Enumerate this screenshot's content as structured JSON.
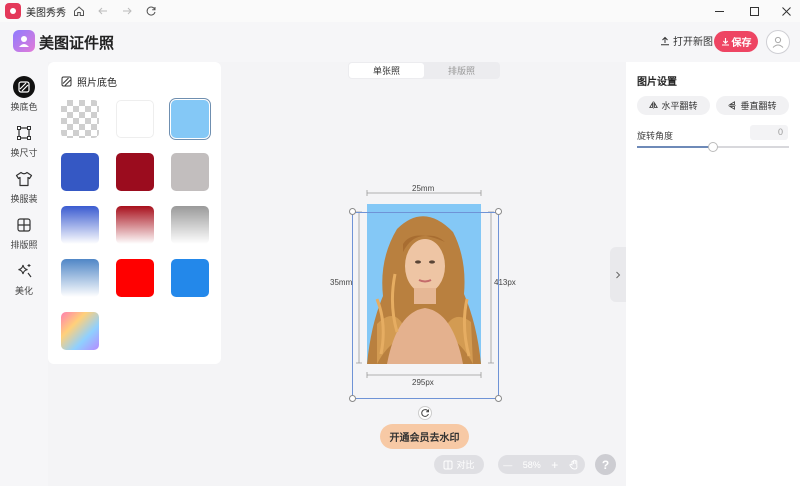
{
  "window": {
    "app_name": "美图秀秀"
  },
  "header": {
    "brand": "美图证件照",
    "open_new": "打开新图",
    "save": "保存"
  },
  "rail": [
    {
      "label": "换底色",
      "icon": "background-color-icon",
      "active": true
    },
    {
      "label": "换尺寸",
      "icon": "crop-size-icon",
      "active": false
    },
    {
      "label": "换服装",
      "icon": "tshirt-icon",
      "active": false
    },
    {
      "label": "排版照",
      "icon": "grid-layout-icon",
      "active": false
    },
    {
      "label": "美化",
      "icon": "sparkle-icon",
      "active": false
    }
  ],
  "color_panel": {
    "title": "照片底色",
    "swatches": [
      {
        "name": "transparent",
        "fill": "checker",
        "selected": false
      },
      {
        "name": "white",
        "fill": "#ffffff",
        "selected": false
      },
      {
        "name": "light-blue",
        "fill": "#84c8f6",
        "selected": true
      },
      {
        "name": "blue",
        "fill": "#3558c4",
        "selected": false
      },
      {
        "name": "dark-red",
        "fill": "#9b0c1e",
        "selected": false
      },
      {
        "name": "grey",
        "fill": "#c2bebe",
        "selected": false
      },
      {
        "name": "blue-gradient",
        "fill": "linear-gradient(#3a5bd0,#ffffff)",
        "selected": false
      },
      {
        "name": "red-gradient",
        "fill": "linear-gradient(#a8101c,#ffffff)",
        "selected": false
      },
      {
        "name": "grey-gradient",
        "fill": "linear-gradient(#9a9a9a,#ffffff)",
        "selected": false
      },
      {
        "name": "sky-gradient",
        "fill": "linear-gradient(#4f86c6,#ffffff)",
        "selected": false
      },
      {
        "name": "red",
        "fill": "#ff0000",
        "selected": false
      },
      {
        "name": "azure",
        "fill": "#2388ea",
        "selected": false
      },
      {
        "name": "rainbow",
        "fill": "linear-gradient(135deg,#ff7fb0,#ffd07a,#8fd0ff,#b58bff)",
        "selected": false
      }
    ]
  },
  "canvas": {
    "tabs": [
      {
        "label": "单张照",
        "active": true
      },
      {
        "label": "排版照",
        "active": false
      }
    ],
    "dim_width_mm": "25mm",
    "dim_height_mm": "35mm",
    "dim_width_px": "295px",
    "dim_height_px": "413px",
    "vip_button": "开通会员去水印",
    "compare": "对比",
    "zoom": "58%"
  },
  "settings": {
    "title": "图片设置",
    "flip_h": "水平翻转",
    "flip_v": "垂直翻转",
    "rotation_label": "旋转角度",
    "rotation_value": "0",
    "rotation_slider_fraction": 0.5
  },
  "colors": {
    "accent": "#ee4563",
    "vip": "#f7c9a5",
    "frame": "#6f93d6",
    "photo_bg": "#84c8f6"
  }
}
